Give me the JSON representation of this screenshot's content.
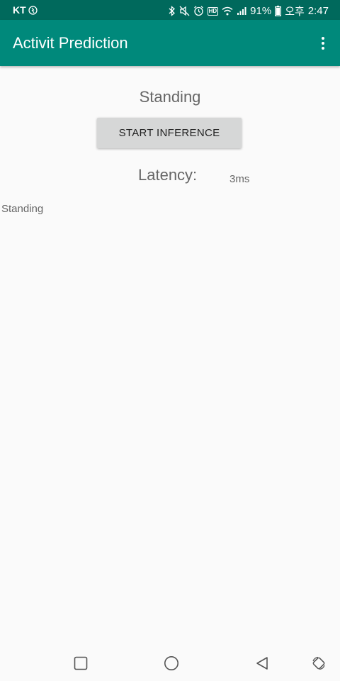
{
  "status_bar": {
    "carrier": "KT",
    "battery_percent": "91%",
    "time_label": "오후",
    "time": "2:47",
    "hd_badge": "HD",
    "color": "#00695c"
  },
  "app_bar": {
    "title": "Activit Prediction",
    "color": "#00897b",
    "overflow_icon": "more-vert-icon"
  },
  "main": {
    "activity_label": "Standing",
    "start_button_label": "START INFERENCE",
    "latency_label": "Latency:",
    "latency_value": "3ms",
    "result_text": "Standing"
  },
  "nav_bar": {
    "icons": [
      "recent-apps-icon",
      "home-icon",
      "back-icon",
      "rotate-screen-icon"
    ]
  }
}
